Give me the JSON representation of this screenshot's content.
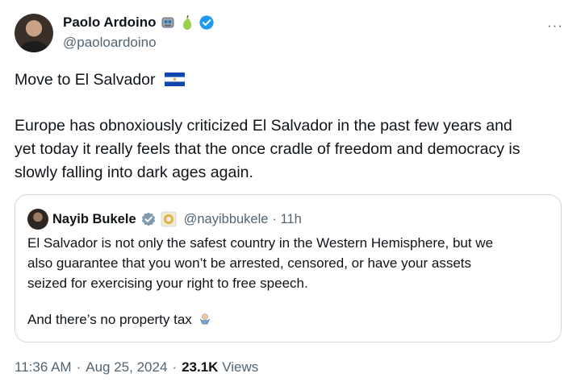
{
  "author": {
    "name": "Paolo Ardoino",
    "handle": "@paoloardoino",
    "emojis": [
      "robot-face-icon",
      "pear-icon"
    ],
    "verified_color": "#1d9bf0"
  },
  "menu": {
    "more_label": "···"
  },
  "tweet": {
    "title_line": "Move to El Salvador",
    "body_lines": [
      "Europe has obnoxiously criticized El Salvador in the past few years and",
      "yet today it really feels that the once cradle of freedom and democracy is",
      "slowly falling into dark ages again."
    ]
  },
  "quoted": {
    "name": "Nayib Bukele",
    "handle": "@nayibbukele",
    "time": "· 11h",
    "badge": "government-gray-check-icon",
    "lines": [
      "El Salvador is not only the safest country in the Western Hemisphere, but we",
      "also guarantee that you won’t be arrested, censored, or have your assets",
      "seized for exercising your right to free speech."
    ],
    "last_line": "And there’s no property tax"
  },
  "footer": {
    "time": "11:36 AM",
    "sep1": "·",
    "date": "Aug 25, 2024",
    "sep2": "·",
    "views": "23.1K",
    "views_label": "Views"
  },
  "colors": {
    "text": "#0f1419",
    "muted": "#536471",
    "border": "#cfd9de",
    "accent": "#1d9bf0"
  }
}
